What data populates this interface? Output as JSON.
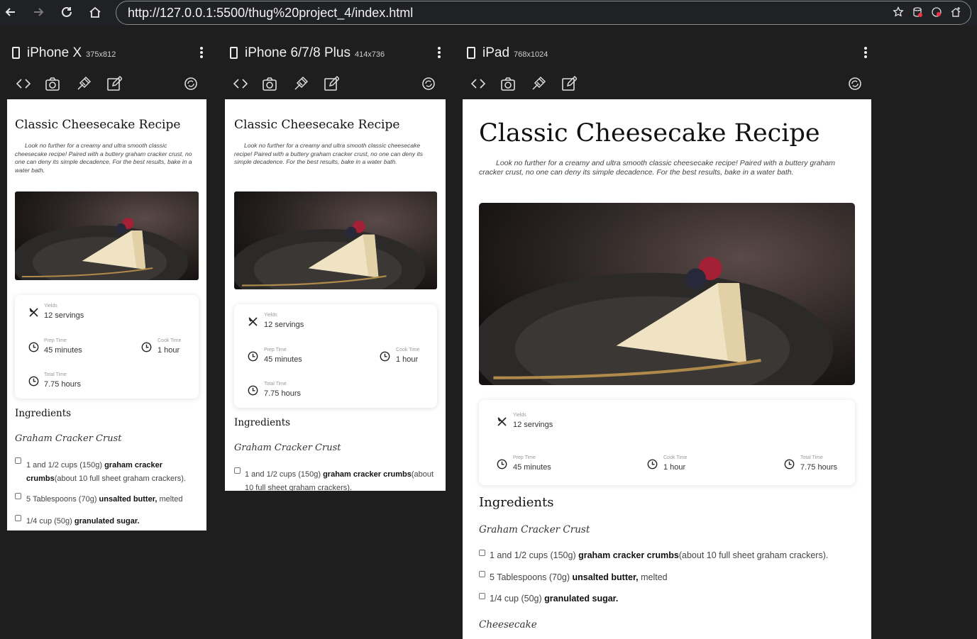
{
  "browser": {
    "url": "http://127.0.0.1:5500/thug%20project_4/index.html"
  },
  "recipe": {
    "title": "Classic Cheesecake Recipe",
    "description": "Look no further for a creamy and ultra smooth classic cheesecake recipe! Paired with a buttery graham cracker crust, no one can deny its simple decadence. For the best results, bake in a water bath.",
    "yields_label": "Yields",
    "yields_value": "12 servings",
    "prep_label": "Prep Time",
    "prep_value": "45 minutes",
    "cook_label": "Cook Time",
    "cook_value": "1 hour",
    "total_label": "Total Time",
    "total_value": "7.75 hours",
    "ingredients_heading": "Ingredients",
    "crust_heading": "Graham Cracker Crust",
    "cheesecake_heading": "Cheesecake",
    "ingredients": [
      {
        "amount": "1 and 1/2 cups (150g) ",
        "item": "graham cracker crumbs",
        "note": "(about 10 full sheet graham crackers)."
      },
      {
        "amount": "5 Tablespoons (70g) ",
        "item": "unsalted butter,",
        "note": " melted"
      },
      {
        "amount": "1/4 cup (50g) ",
        "item": "granulated sugar.",
        "note": ""
      }
    ]
  },
  "devices": [
    {
      "name": "iPhone X",
      "size": "375x812"
    },
    {
      "name": "iPhone 6/7/8 Plus",
      "size": "414x736"
    },
    {
      "name": "iPad",
      "size": "768x1024"
    }
  ]
}
